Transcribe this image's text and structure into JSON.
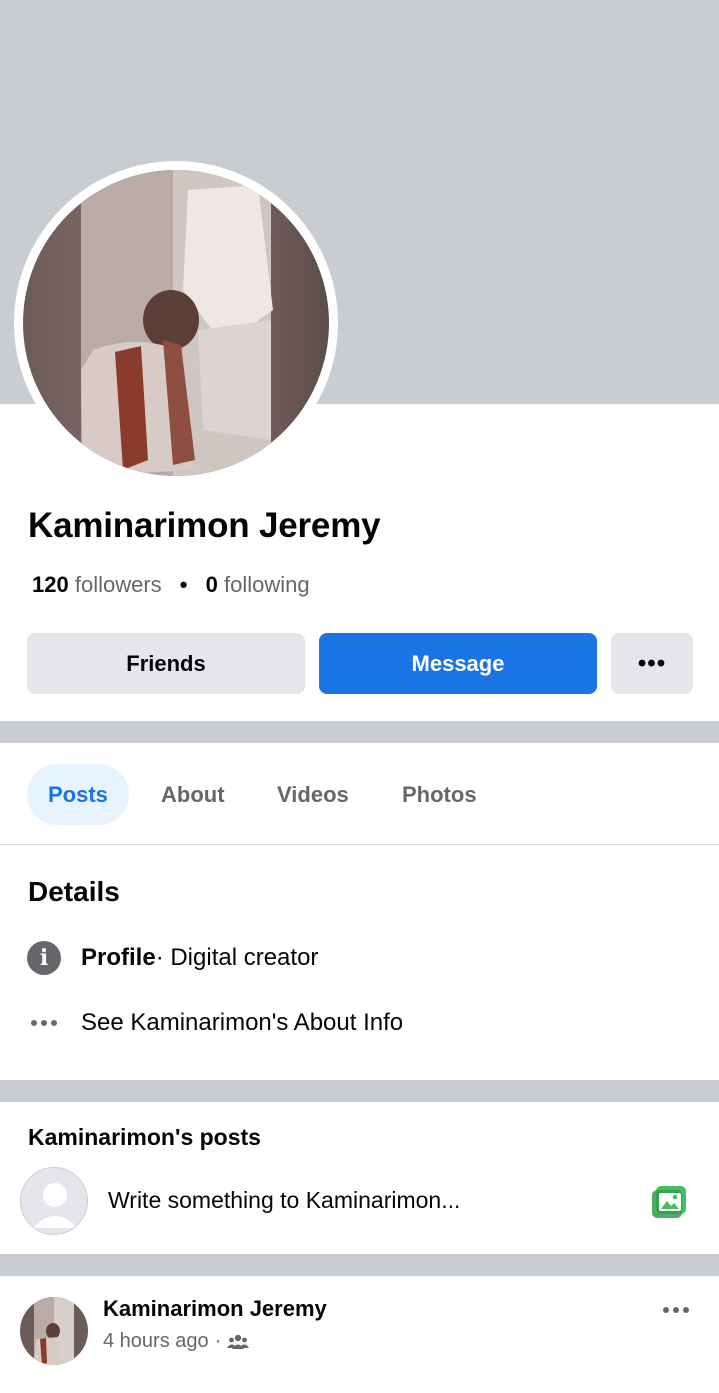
{
  "profile": {
    "name": "Kaminarimon Jeremy",
    "followers_count": "120",
    "followers_label": "followers",
    "following_count": "0",
    "following_label": "following"
  },
  "actions": {
    "friends_label": "Friends",
    "message_label": "Message",
    "more_label": "•••"
  },
  "tabs": [
    {
      "label": "Posts",
      "active": true
    },
    {
      "label": "About",
      "active": false
    },
    {
      "label": "Videos",
      "active": false
    },
    {
      "label": "Photos",
      "active": false
    }
  ],
  "details": {
    "title": "Details",
    "profile_label": "Profile",
    "profile_value": " · Digital creator",
    "about_link": "See Kaminarimon's About Info"
  },
  "posts": {
    "title": "Kaminarimon's posts",
    "composer_placeholder": "Write something to Kaminarimon..."
  },
  "post": {
    "author": "Kaminarimon Jeremy",
    "time": "4 hours ago",
    "separator": "·",
    "audience_icon": "friends-icon"
  },
  "colors": {
    "accent": "#1b74e4",
    "cover": "#c9ccd1",
    "secondary_text": "#65676b",
    "photo_icon": "#45bd62"
  }
}
